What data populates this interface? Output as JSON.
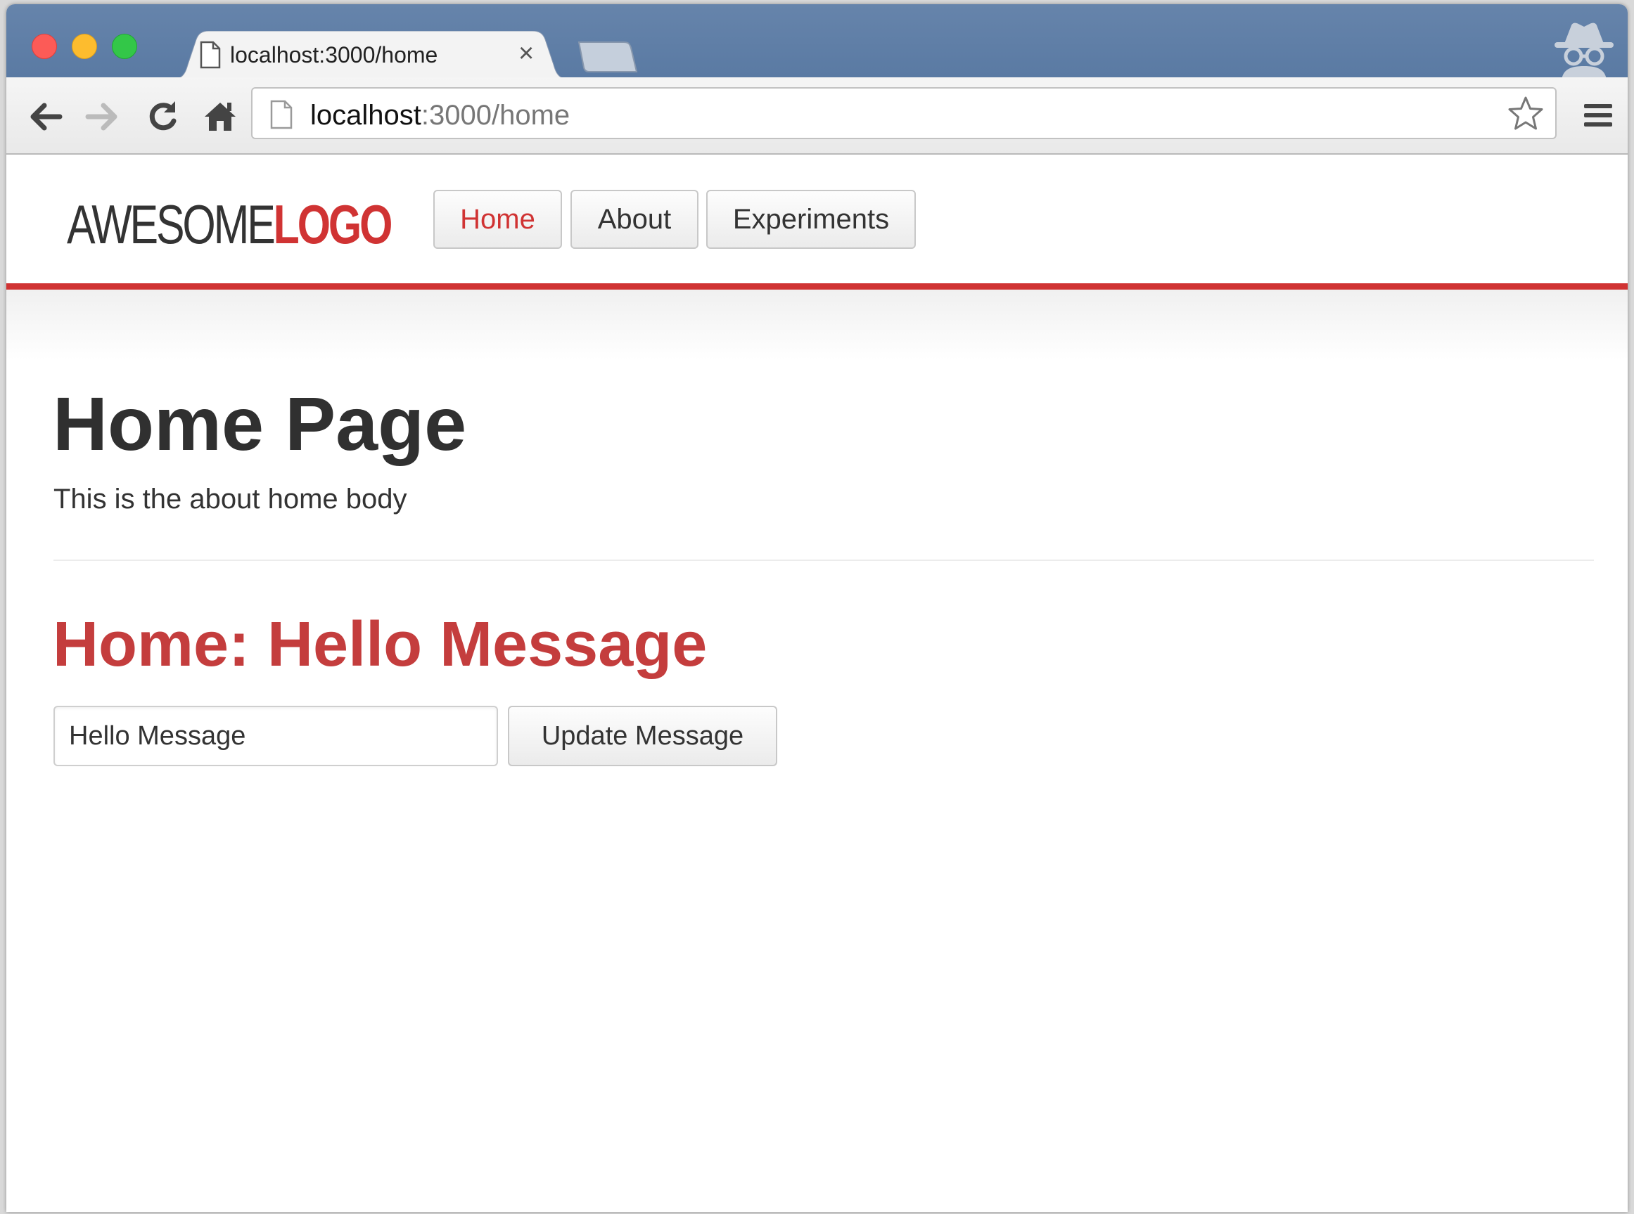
{
  "browser": {
    "tab": {
      "title": "localhost:3000/home",
      "close_glyph": "×"
    },
    "address_bar": {
      "host": "localhost",
      "path": ":3000/home"
    },
    "icons": {
      "back": "back-arrow-icon",
      "forward": "forward-arrow-icon",
      "reload": "reload-icon",
      "home": "home-icon",
      "page": "page-icon",
      "bookmark": "star-icon",
      "menu": "hamburger-menu-icon",
      "incognito": "incognito-icon"
    }
  },
  "site": {
    "logo": {
      "part1": "AWESOME",
      "part2": "LOGO"
    },
    "nav": [
      {
        "label": "Home",
        "active": true
      },
      {
        "label": "About",
        "active": false
      },
      {
        "label": "Experiments",
        "active": false
      }
    ],
    "accent_color": "#d03333"
  },
  "main": {
    "title": "Home Page",
    "body": "This is the about home body",
    "section_title": "Home: Hello Message",
    "message_input": {
      "value": "Hello Message"
    },
    "update_button_label": "Update Message"
  }
}
